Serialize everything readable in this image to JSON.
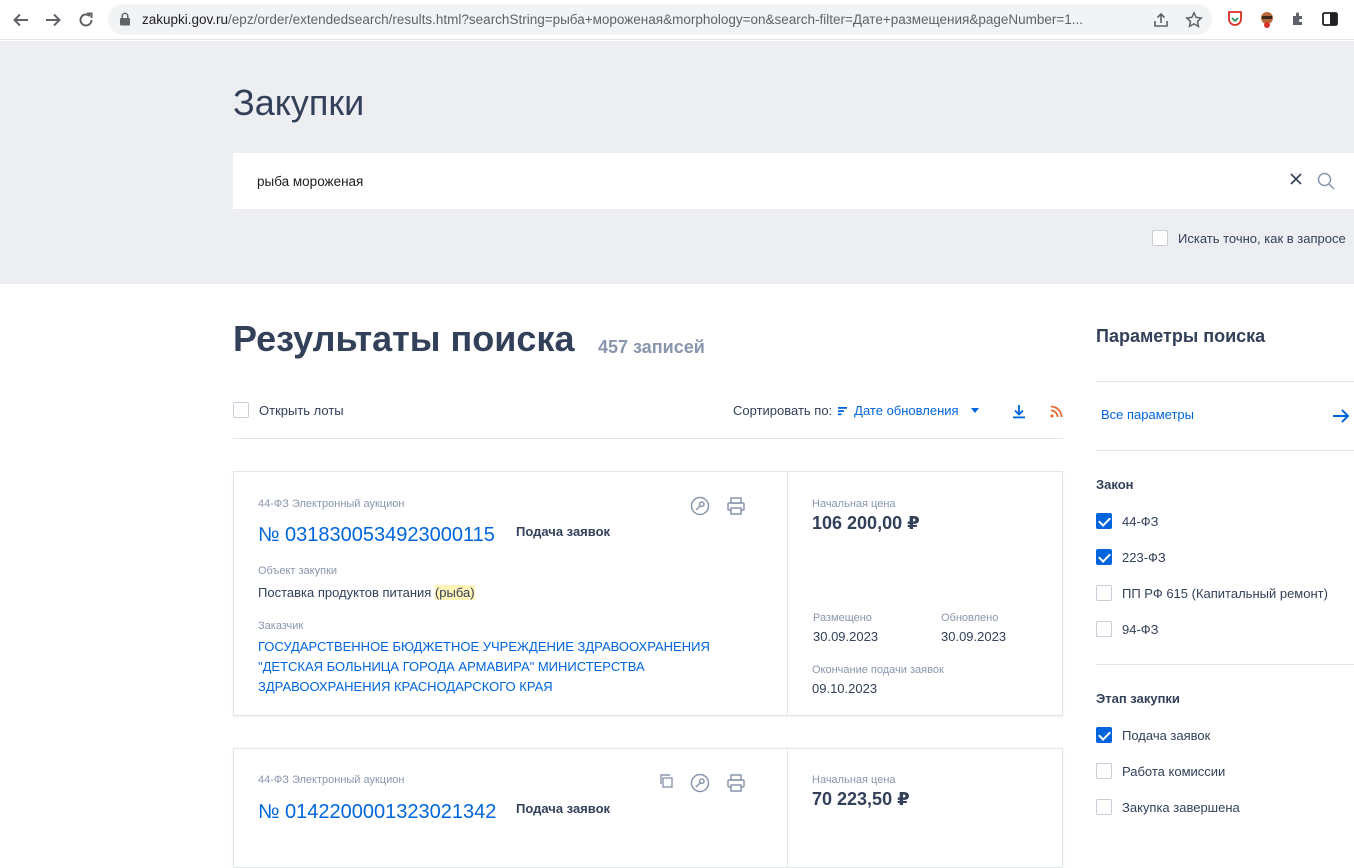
{
  "browser": {
    "url_host": "zakupki.gov.ru",
    "url_path": "/epz/order/extendedsearch/results.html?searchString=рыба+мороженая&morphology=on&search-filter=Дате+размещения&pageNumber=1..."
  },
  "hero": {
    "title": "Закупки",
    "search_value": "рыба мороженая",
    "exact_label": "Искать точно, как в запросе"
  },
  "results": {
    "title": "Результаты поиска",
    "count": "457 записей",
    "open_lots_label": "Открыть лоты",
    "sort_label": "Сортировать по:",
    "sort_value": "Дате обновления"
  },
  "cards": [
    {
      "type": "44-ФЗ Электронный аукцион",
      "number": "№ 0318300534923000115",
      "status": "Подача заявок",
      "object_label": "Объект закупки",
      "object_before": "Поставка продуктов питания ",
      "object_highlight": "(рыба)",
      "customer_label": "Заказчик",
      "customer": "ГОСУДАРСТВЕННОЕ БЮДЖЕТНОЕ УЧРЕЖДЕНИЕ ЗДРАВООХРАНЕНИЯ \"ДЕТСКАЯ БОЛЬНИЦА ГОРОДА АРМАВИРА\" МИНИСТЕРСТВА ЗДРАВООХРАНЕНИЯ КРАСНОДАРСКОГО КРАЯ",
      "price_label": "Начальная цена",
      "price": "106 200,00 ₽",
      "posted_label": "Размещено",
      "posted": "30.09.2023",
      "updated_label": "Обновлено",
      "updated": "30.09.2023",
      "deadline_label": "Окончание подачи заявок",
      "deadline": "09.10.2023"
    },
    {
      "type": "44-ФЗ Электронный аукцион",
      "number": "№ 0142200001323021342",
      "status": "Подача заявок",
      "price_label": "Начальная цена",
      "price": "70 223,50 ₽"
    }
  ],
  "sidebar": {
    "title": "Параметры поиска",
    "all_params": "Все параметры",
    "law_title": "Закон",
    "laws": [
      {
        "label": "44-ФЗ",
        "checked": true
      },
      {
        "label": "223-ФЗ",
        "checked": true
      },
      {
        "label": "ПП РФ 615 (Капитальный ремонт)",
        "checked": false
      },
      {
        "label": "94-ФЗ",
        "checked": false
      }
    ],
    "stage_title": "Этап закупки",
    "stages": [
      {
        "label": "Подача заявок",
        "checked": true
      },
      {
        "label": "Работа комиссии",
        "checked": false
      },
      {
        "label": "Закупка завершена",
        "checked": false
      }
    ]
  },
  "colors": {
    "accent": "#0065dd",
    "text": "#334059",
    "muted": "#8a96ad",
    "hero_bg": "#eceef2",
    "rss": "#e8652b"
  }
}
